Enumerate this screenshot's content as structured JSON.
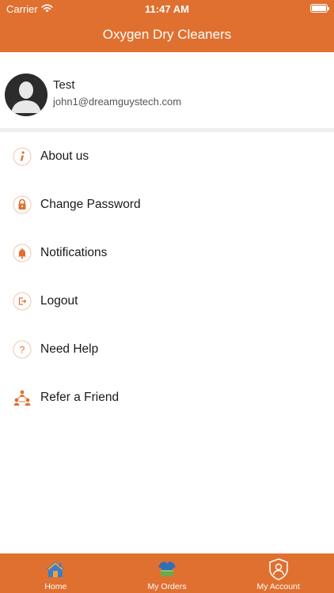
{
  "status_bar": {
    "carrier": "Carrier",
    "time": "11:47 AM"
  },
  "header": {
    "title": "Oxygen Dry Cleaners"
  },
  "profile": {
    "name": "Test",
    "email": "john1@dreamguystech.com"
  },
  "menu": {
    "items": [
      {
        "label": "About us",
        "icon": "info-icon"
      },
      {
        "label": "Change Password",
        "icon": "lock-icon"
      },
      {
        "label": "Notifications",
        "icon": "bell-icon"
      },
      {
        "label": "Logout",
        "icon": "logout-icon"
      },
      {
        "label": "Need Help",
        "icon": "help-icon"
      },
      {
        "label": "Refer a Friend",
        "icon": "refer-friend-icon"
      }
    ]
  },
  "tabbar": {
    "tabs": [
      {
        "label": "Home",
        "icon": "home-icon"
      },
      {
        "label": "My Orders",
        "icon": "orders-icon"
      },
      {
        "label": "My Account",
        "icon": "account-icon",
        "selected": true
      }
    ]
  },
  "colors": {
    "accent": "#e07030",
    "text": "#1a1a1a",
    "separator": "#eeeeee"
  }
}
